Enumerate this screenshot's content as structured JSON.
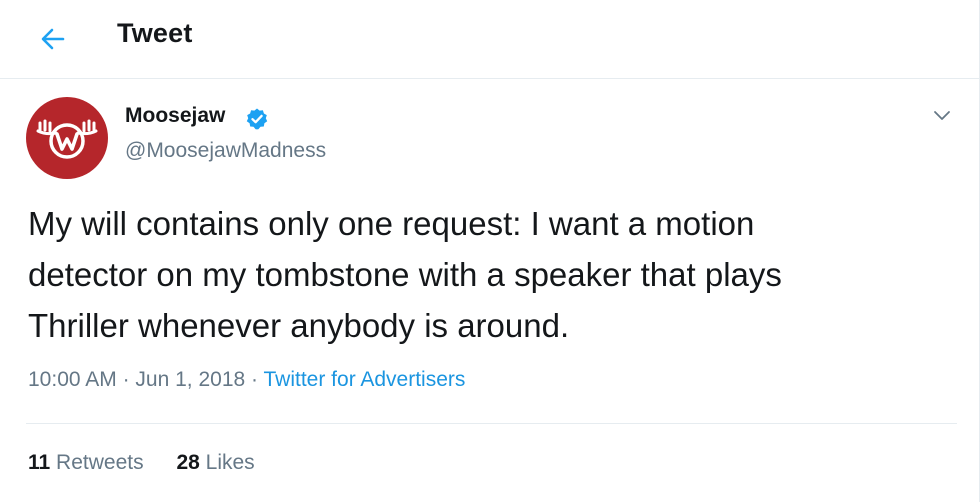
{
  "header": {
    "title": "Tweet",
    "back_icon": "arrow-left-icon"
  },
  "author": {
    "name": "Moosejaw",
    "handle": "@MoosejawMadness",
    "verified": true,
    "avatar_color": "#b5262b",
    "avatar_logo": "moose-w-logo"
  },
  "tweet": {
    "text": "My will contains only one request: I want a motion\ndetector on my tombstone with a speaker that plays\nThriller whenever anybody is around.",
    "time": "10:00 AM",
    "separator": "·",
    "date": "Jun 1, 2018",
    "source": "Twitter for Advertisers"
  },
  "stats": {
    "retweets_count": "11",
    "retweets_label": "Retweets",
    "likes_count": "28",
    "likes_label": "Likes"
  },
  "colors": {
    "accent": "#1da1f2",
    "link": "#1b95e0",
    "secondary_text": "#657786",
    "divider": "#e6ecf0"
  }
}
